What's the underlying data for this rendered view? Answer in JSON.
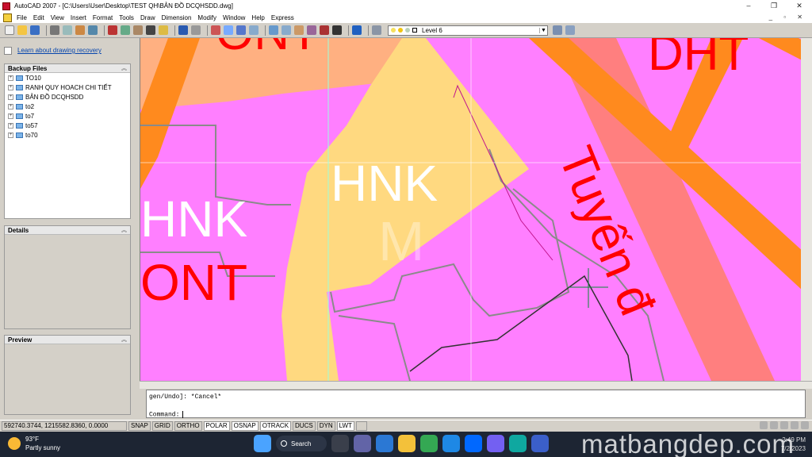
{
  "window": {
    "title": "AutoCAD 2007 - [C:\\Users\\User\\Desktop\\TEST QH\\BẢN ĐỒ DCQHSDD.dwg]",
    "controls": [
      "–",
      "❐",
      "✕"
    ]
  },
  "menu": {
    "items": [
      "File",
      "Edit",
      "View",
      "Insert",
      "Format",
      "Tools",
      "Draw",
      "Dimension",
      "Modify",
      "Window",
      "Help",
      "Express"
    ],
    "mdi_controls": "_ ▫ ✕"
  },
  "toolbar": {
    "layer_value": "Level 6",
    "colors": {
      "accent": "#2060c0"
    }
  },
  "recovery": {
    "link": "Learn about drawing recovery"
  },
  "backup_files": {
    "header": "Backup Files",
    "items": [
      "TO10",
      "RANH QUY HOACH CHI TIẾT",
      "BẢN ĐỒ DCQHSDD",
      "to2",
      "to7",
      "to57",
      "to70"
    ]
  },
  "details": {
    "header": "Details"
  },
  "preview": {
    "header": "Preview"
  },
  "drawing": {
    "labels": {
      "top_left": "ONT",
      "top_right": "DHT",
      "center": "HNK",
      "left": "HNK",
      "left_bottom": "ONT",
      "faint": "M",
      "road": "Tuyến đ"
    },
    "colors": {
      "background": "#ff7fff",
      "orange": "#ff8a1e",
      "salmon": "#ff7f7f",
      "yellow": "#ffd980",
      "peach": "#ffb081",
      "text_red": "#ff0000"
    }
  },
  "command": {
    "line1": "gen/Undo]: *Cancel*",
    "line2": "Command:"
  },
  "status": {
    "coords": "592740.3744, 1215582.8360, 0.0000",
    "buttons": [
      "SNAP",
      "GRID",
      "ORTHO",
      "POLAR",
      "OSNAP",
      "OTRACK",
      "DUCS",
      "DYN",
      "LWT"
    ],
    "active": [
      "POLAR",
      "OSNAP",
      "OTRACK",
      "LWT"
    ]
  },
  "taskbar": {
    "temp": "93°F",
    "condition": "Partly sunny",
    "search": "Search",
    "lang": "ENG",
    "time": "2:49 PM",
    "date": "7/2/2023"
  },
  "watermark": "matbangdep.com"
}
